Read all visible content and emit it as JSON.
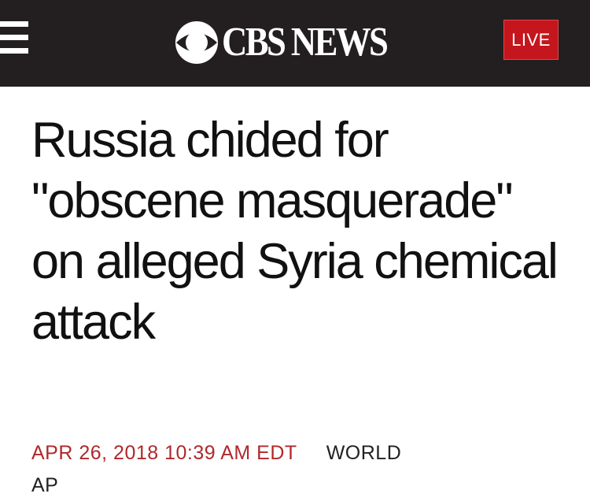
{
  "header": {
    "menu_icon": "hamburger-menu-icon",
    "logo_icon": "cbs-eye-icon",
    "brand": "CBS NEWS",
    "live_label": "LIVE",
    "colors": {
      "bar": "#231f20",
      "live": "#c4161c"
    }
  },
  "article": {
    "headline": "Russia chided for \"obscene masquerade\" on alleged Syria chemical attack",
    "dateline": "APR 26, 2018 10:39 AM EDT",
    "section": "WORLD",
    "byline": "AP",
    "colors": {
      "dateline": "#b0282b"
    }
  }
}
